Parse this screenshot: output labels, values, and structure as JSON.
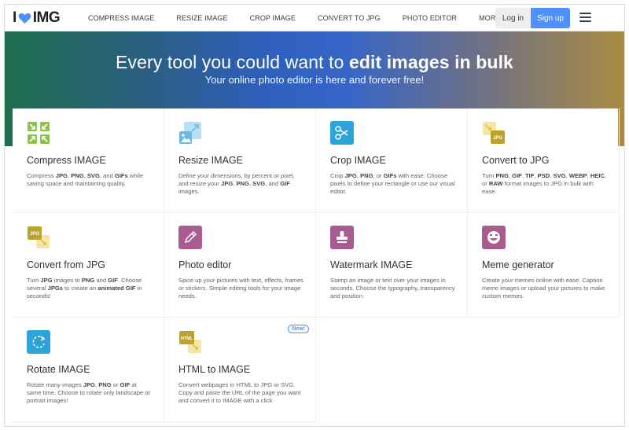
{
  "header": {
    "logo_left": "I",
    "logo_right": "IMG",
    "nav": [
      {
        "label": "COMPRESS IMAGE"
      },
      {
        "label": "RESIZE IMAGE"
      },
      {
        "label": "CROP IMAGE"
      },
      {
        "label": "CONVERT TO JPG"
      },
      {
        "label": "PHOTO EDITOR"
      },
      {
        "label": "MORE TOOLS"
      }
    ],
    "login_label": "Log in",
    "signup_label": "Sign up"
  },
  "hero": {
    "title_pre": "Every tool you could want to ",
    "title_bold": "edit images in bulk",
    "subtitle": "Your online photo editor is here and forever free!"
  },
  "tools": [
    {
      "title": "Compress IMAGE",
      "icon": "compress-icon",
      "color": "#8bc34a",
      "desc": [
        [
          "Compress ",
          false
        ],
        [
          "JPG",
          true
        ],
        [
          ", ",
          false
        ],
        [
          "PNG",
          true
        ],
        [
          ", ",
          false
        ],
        [
          "SVG",
          true
        ],
        [
          ", and ",
          false
        ],
        [
          "GIFs",
          true
        ],
        [
          " while saving space and maintaining quality.",
          false
        ]
      ]
    },
    {
      "title": "Resize IMAGE",
      "icon": "resize-icon",
      "color": "#68b9e8",
      "desc": [
        [
          "Define your dimensions, by percent or pixel, and resize your ",
          false
        ],
        [
          "JPG",
          true
        ],
        [
          ", ",
          false
        ],
        [
          "PNG",
          true
        ],
        [
          ", ",
          false
        ],
        [
          "SVG",
          true
        ],
        [
          ", and ",
          false
        ],
        [
          "GIF",
          true
        ],
        [
          " images.",
          false
        ]
      ]
    },
    {
      "title": "Crop IMAGE",
      "icon": "scissors-icon",
      "color": "#2ba4d9",
      "desc": [
        [
          "Crop ",
          false
        ],
        [
          "JPG",
          true
        ],
        [
          ", ",
          false
        ],
        [
          "PNG",
          true
        ],
        [
          ", or ",
          false
        ],
        [
          "GIFs",
          true
        ],
        [
          " with ease; Choose pixels to define your rectangle or use our visual editor.",
          false
        ]
      ]
    },
    {
      "title": "Convert to JPG",
      "icon": "convert-to-jpg-icon",
      "color": "#d6c03a",
      "icon_text": "JPG",
      "desc": [
        [
          "Turn ",
          false
        ],
        [
          "PNG",
          true
        ],
        [
          ", ",
          false
        ],
        [
          "GIF",
          true
        ],
        [
          ", ",
          false
        ],
        [
          "TIF",
          true
        ],
        [
          ", ",
          false
        ],
        [
          "PSD",
          true
        ],
        [
          ", ",
          false
        ],
        [
          "SVG",
          true
        ],
        [
          ", ",
          false
        ],
        [
          "WEBP",
          true
        ],
        [
          ", ",
          false
        ],
        [
          "HEIC",
          true
        ],
        [
          ", or ",
          false
        ],
        [
          "RAW",
          true
        ],
        [
          " format images to JPG in bulk with ease.",
          false
        ]
      ]
    },
    {
      "title": "Convert from JPG",
      "icon": "convert-from-jpg-icon",
      "color": "#d6c03a",
      "icon_text": "JPG",
      "desc": [
        [
          "Turn ",
          false
        ],
        [
          "JPG",
          true
        ],
        [
          " images to ",
          false
        ],
        [
          "PNG",
          true
        ],
        [
          " and ",
          false
        ],
        [
          "GIF",
          true
        ],
        [
          ". Choose several ",
          false
        ],
        [
          "JPGs",
          true
        ],
        [
          " to create an ",
          false
        ],
        [
          "animated GIF",
          true
        ],
        [
          " in seconds!",
          false
        ]
      ]
    },
    {
      "title": "Photo editor",
      "icon": "pencil-icon",
      "color": "#a85c8f",
      "desc": [
        [
          "Spice up your pictures with text, effects, frames or stickers. Simple editing tools for your image needs.",
          false
        ]
      ]
    },
    {
      "title": "Watermark IMAGE",
      "icon": "stamp-icon",
      "color": "#a85c8f",
      "desc": [
        [
          "Stamp an image or text over your images in seconds. Choose the typography, transparency and position.",
          false
        ]
      ]
    },
    {
      "title": "Meme generator",
      "icon": "smiley-icon",
      "color": "#a85c8f",
      "desc": [
        [
          "Create your memes online with ease. Caption meme images or upload your pictures to make custom memes.",
          false
        ]
      ]
    },
    {
      "title": "Rotate IMAGE",
      "icon": "rotate-icon",
      "color": "#2ba4d9",
      "desc": [
        [
          "Rotate many images ",
          false
        ],
        [
          "JPG",
          true
        ],
        [
          ", ",
          false
        ],
        [
          "PNG",
          true
        ],
        [
          " or ",
          false
        ],
        [
          "GIF",
          true
        ],
        [
          " at same time. Choose to rotate only landscape or portrait images!",
          false
        ]
      ]
    },
    {
      "title": "HTML to IMAGE",
      "icon": "html-to-image-icon",
      "color": "#d6c03a",
      "icon_text": "HTML",
      "badge": "New!",
      "desc": [
        [
          "Convert webpages in HTML to JPG or SVG. Copy and paste the URL of the page you want and convert it to IMAGE with a click",
          false
        ]
      ]
    }
  ]
}
